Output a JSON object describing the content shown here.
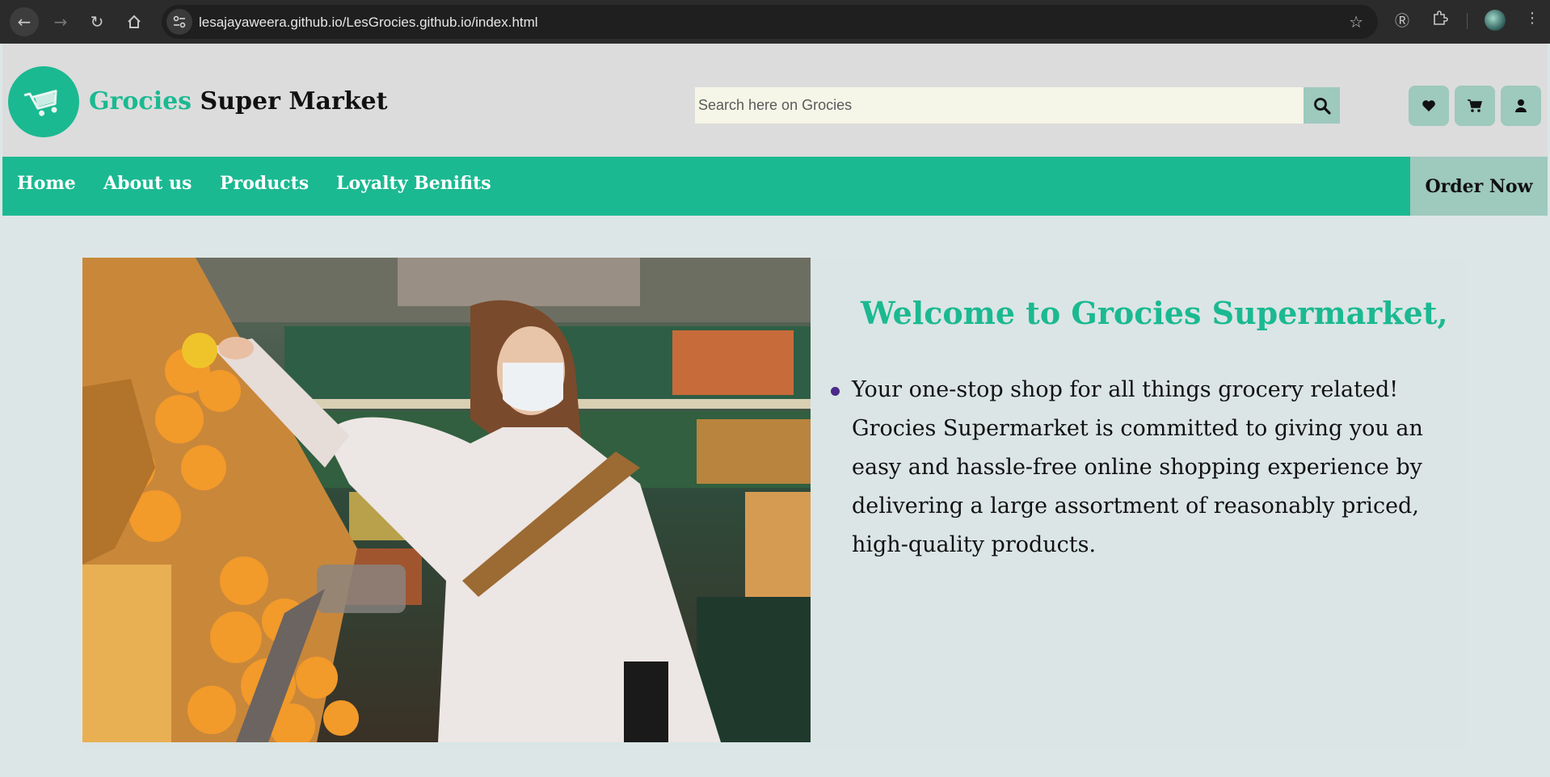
{
  "browser": {
    "url": "lesajayaweera.github.io/LesGrocies.github.io/index.html"
  },
  "header": {
    "brand_part1": "Grocies",
    "brand_part2": "Super Market",
    "search_placeholder": "Search here on Grocies",
    "icons": [
      "heart-icon",
      "cart-icon",
      "user-icon"
    ]
  },
  "nav": {
    "items": [
      "Home",
      "About us",
      "Products",
      "Loyalty Benifits"
    ],
    "order_now": "Order Now"
  },
  "hero": {
    "title": "Welcome to Grocies Supermarket,",
    "bullets": [
      "Your one-stop shop for all things grocery related! Grocies Supermarket is committed to giving you an easy and hassle-free online shopping experience by delivering a large assortment of reasonably priced, high-quality products."
    ]
  },
  "colors": {
    "brand_green": "#1bb991",
    "muted_teal": "#9ec9bd",
    "header_bg": "#dcdcdc",
    "page_bg": "#dde6e6"
  }
}
